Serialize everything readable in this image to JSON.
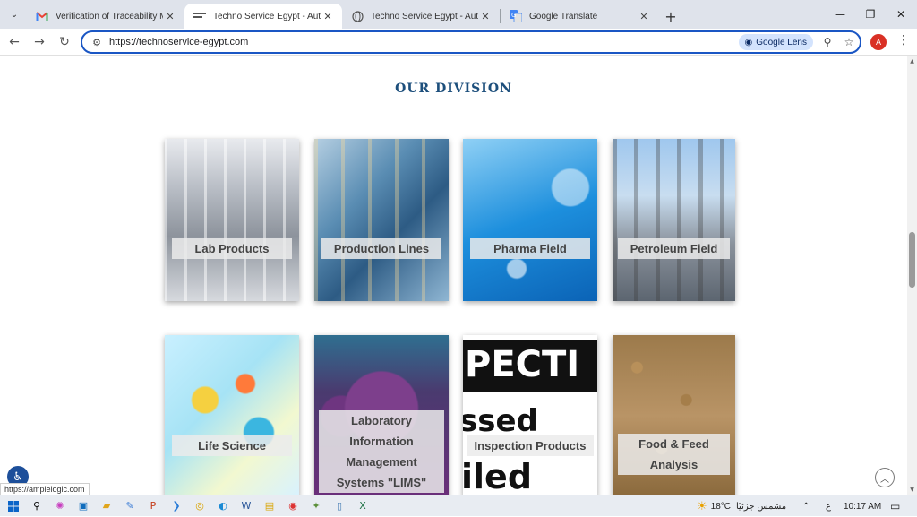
{
  "tabs": [
    {
      "title": "Verification of Traceability Matr",
      "favicon": "gmail-icon",
      "active": false
    },
    {
      "title": "Techno Service Egypt - Automa",
      "favicon": "site-icon",
      "active": true
    },
    {
      "title": "Techno Service Egypt - Automa",
      "favicon": "globe-icon",
      "active": false
    },
    {
      "title": "Google Translate",
      "favicon": "translate-icon",
      "active": false
    }
  ],
  "toolbar": {
    "url": "https://technoservice-egypt.com",
    "lens_label": "Google Lens",
    "avatar_letter": "A"
  },
  "page": {
    "heading": "OUR DIVISION",
    "divisions": [
      {
        "label": "Lab Products"
      },
      {
        "label": "Production Lines"
      },
      {
        "label": "Pharma Field"
      },
      {
        "label": "Petroleum Field"
      },
      {
        "label": "Life Science"
      },
      {
        "label": "Laboratory Information Management Systems \"LIMS\""
      },
      {
        "label": "Inspection Products"
      },
      {
        "label": "Food & Feed Analysis"
      }
    ],
    "inspection_image_text": [
      "PECTI",
      "ssed",
      "iled"
    ]
  },
  "status": {
    "hover_url": "https://amplelogic.com"
  },
  "taskbar": {
    "weather_temp": "18°C",
    "weather_text": "مشمس جزئيًا",
    "lang": "ع",
    "time": "10:17 AM"
  },
  "colors": {
    "heading": "#1d4f7c",
    "omnibox_border": "#1a56c4",
    "lens_bg": "#d3e3fd"
  }
}
